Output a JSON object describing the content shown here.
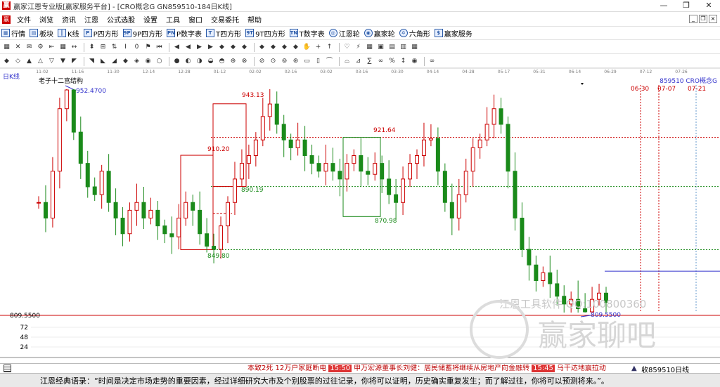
{
  "window": {
    "title": "赢家江恩专业版[赢家服务平台] - [CRO概念G  GN859510-184日K线]",
    "controls": [
      "—",
      "❐",
      "✕"
    ]
  },
  "menu": [
    "文件",
    "浏览",
    "资讯",
    "江恩",
    "公式选股",
    "设置",
    "工具",
    "窗口",
    "交易委托",
    "帮助"
  ],
  "mdi_controls": [
    "_",
    "❐",
    "×"
  ],
  "toolbar1": [
    {
      "icon": "row-icon",
      "label": "行情"
    },
    {
      "icon": "block-icon",
      "label": "板块"
    },
    {
      "icon": "kline-icon",
      "label": "K线"
    },
    {
      "icon": "p-square-icon",
      "label": "P四方形"
    },
    {
      "icon": "9p-square-icon",
      "label": "9P四方形"
    },
    {
      "icon": "p-digit-icon",
      "label": "P数字表"
    },
    {
      "icon": "t-square-icon",
      "label": "T四方形"
    },
    {
      "icon": "9t-square-icon",
      "label": "9T四方形"
    },
    {
      "icon": "t-digit-icon",
      "label": "T数字表"
    },
    {
      "icon": "gann-wheel-icon",
      "label": "江恩轮"
    },
    {
      "icon": "winner-wheel-icon",
      "label": "赢家轮"
    },
    {
      "icon": "hexagon-icon",
      "label": "六角形"
    },
    {
      "icon": "service-icon",
      "label": "赢家服务"
    }
  ],
  "toolbar1_badges": [
    "P",
    "9P",
    "PN",
    "T",
    "9T",
    "TN"
  ],
  "toolbar2_icons": [
    "▦",
    "✕",
    "✉",
    "⚙",
    "⇤",
    "▦",
    "↔",
    "⬍",
    "⊞",
    "⇅",
    "Ⅰ",
    "0",
    "⚑",
    "⏮",
    "◀",
    "◀",
    "▶",
    "▶",
    "◆",
    "◆",
    "◆",
    "◆",
    "◆",
    "◆",
    "◆",
    "✋",
    "+",
    "↑",
    "♡",
    "⚡",
    "▦",
    "▣",
    "▤",
    "▥",
    "▦"
  ],
  "toolbar3_icons": [
    "◆",
    "◇",
    "▲",
    "△",
    "▽",
    "▼",
    "◤",
    "◥",
    "◣",
    "◢",
    "◆",
    "◈",
    "◉",
    "○",
    "●",
    "◐",
    "◑",
    "◒",
    "◓",
    "⊕",
    "⊗",
    "⊘",
    "⊙",
    "⊚",
    "⊛",
    "▭",
    "▯",
    "⌒",
    "⌓",
    "⊿",
    "∑",
    "∞",
    "%",
    "↕",
    "◉",
    "∞"
  ],
  "chart": {
    "period_label": "日K线",
    "structure_label": "老子十二宫结构",
    "symbol_label": "859510  CRO概念G",
    "date_ticks": [
      "11-02",
      "11-16",
      "11-30",
      "12-14",
      "12-28",
      "01-12",
      "02-02",
      "02-16",
      "03-02",
      "03-16",
      "03-30",
      "04-14",
      "04-28",
      "05-17",
      "05-31",
      "06-14",
      "06-29",
      "07-12",
      "07-26"
    ],
    "future_dates": [
      "06-30",
      "07-07",
      "07-21"
    ],
    "ref_line_label": "809.5500",
    "volume_ticks": [
      "72",
      "48",
      "24"
    ],
    "price_annotations": [
      {
        "text": "952.4700",
        "color": "#3333cc"
      },
      {
        "text": "943.13",
        "color": "#cc0000"
      },
      {
        "text": "910.20",
        "color": "#cc0000"
      },
      {
        "text": "890.19",
        "color": "#1a8a1a"
      },
      {
        "text": "849.80",
        "color": "#1a8a1a"
      },
      {
        "text": "921.64",
        "color": "#cc0000"
      },
      {
        "text": "870.98",
        "color": "#1a8a1a"
      },
      {
        "text": "809.5500",
        "color": "#3333cc"
      }
    ],
    "watermark1": "江恩工具软件 QQ:100800360",
    "watermark2": "赢家聊吧"
  },
  "chart_data": {
    "type": "candlestick",
    "title": "老子十二宫结构",
    "xlabel": "",
    "ylabel": "",
    "series_name": "",
    "ohlc_close": [
      880,
      870,
      900,
      940,
      952,
      925,
      905,
      890,
      885,
      900,
      880,
      870,
      860,
      875,
      880,
      870,
      875,
      865,
      860,
      858,
      870,
      880,
      875,
      860,
      852,
      850,
      865,
      880,
      895,
      905,
      910,
      920,
      935,
      943,
      930,
      920,
      915,
      920,
      910,
      905,
      900,
      905,
      900,
      895,
      905,
      910,
      900,
      898,
      905,
      895,
      885,
      880,
      895,
      905,
      910,
      920,
      921,
      900,
      880,
      870,
      885,
      900,
      915,
      920,
      930,
      940,
      930,
      900,
      870,
      850,
      840,
      830,
      835,
      828,
      820,
      815,
      818,
      812,
      810,
      818,
      822,
      816
    ],
    "levels": [
      952.47,
      943.13,
      921.64,
      910.2,
      890.19,
      870.98,
      849.8,
      809.55
    ],
    "lines": {
      "dotted_red": [
        921.64
      ],
      "dotted_green": [
        890.19,
        849.8
      ],
      "ref_line": 809.55
    }
  },
  "status": {
    "ticker": [
      {
        "type": "n",
        "text": "本致2死 12万户家庭断电"
      },
      {
        "type": "t",
        "text": "15:50"
      },
      {
        "type": "n",
        "text": "申万宏源董事长刘健：居民储蓄将继续从房地产向金融转"
      },
      {
        "type": "t",
        "text": "15:45"
      },
      {
        "type": "n",
        "text": "乌干达地震拉动"
      }
    ],
    "symbol": "收859510日线"
  },
  "quote": "江恩经典语录：“时间是决定市场走势的重要因素，经过详细研究大市及个别股票的过往记录，你将可以证明，历史确实重复发生；而了解过往，你将可以预测将来。”。"
}
